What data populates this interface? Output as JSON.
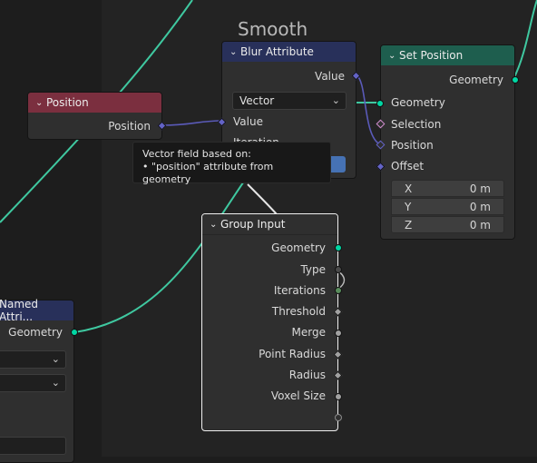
{
  "frame": {
    "title": "Smooth"
  },
  "tooltip": {
    "line1": "Vector field based on:",
    "line2": "• \"position\" attribute from geometry"
  },
  "position_node": {
    "title": "Position",
    "output_label": "Position",
    "header_color": "#7b2f3f"
  },
  "blur_node": {
    "title": "Blur Attribute",
    "output_label": "Value",
    "dropdown_value": "Vector",
    "input_value_label": "Value",
    "input_iterations_label": "Iteration",
    "header_color": "#28305a"
  },
  "set_position_node": {
    "title": "Set Position",
    "output_label": "Geometry",
    "inputs": [
      "Geometry",
      "Selection",
      "Position",
      "Offset"
    ],
    "offset": [
      {
        "axis": "X",
        "value": "0 m"
      },
      {
        "axis": "Y",
        "value": "0 m"
      },
      {
        "axis": "Z",
        "value": "0 m"
      }
    ],
    "header_color": "#1e5e4e"
  },
  "group_input_node": {
    "title": "Group Input",
    "outputs": [
      "Geometry",
      "Type",
      "Iterations",
      "Threshold",
      "Merge",
      "Point Radius",
      "Radius",
      "Voxel Size"
    ]
  },
  "named_attr_node": {
    "title": "Named Attri...",
    "output_label": "Geometry"
  },
  "colors": {
    "geometry_socket": "#00d6a3",
    "vector_socket": "#6363c7",
    "float_socket": "#a1a1a1",
    "int_socket": "#598c5c",
    "wire_geometry": "#3fc8a0",
    "wire_vector": "#5a5ab8"
  }
}
